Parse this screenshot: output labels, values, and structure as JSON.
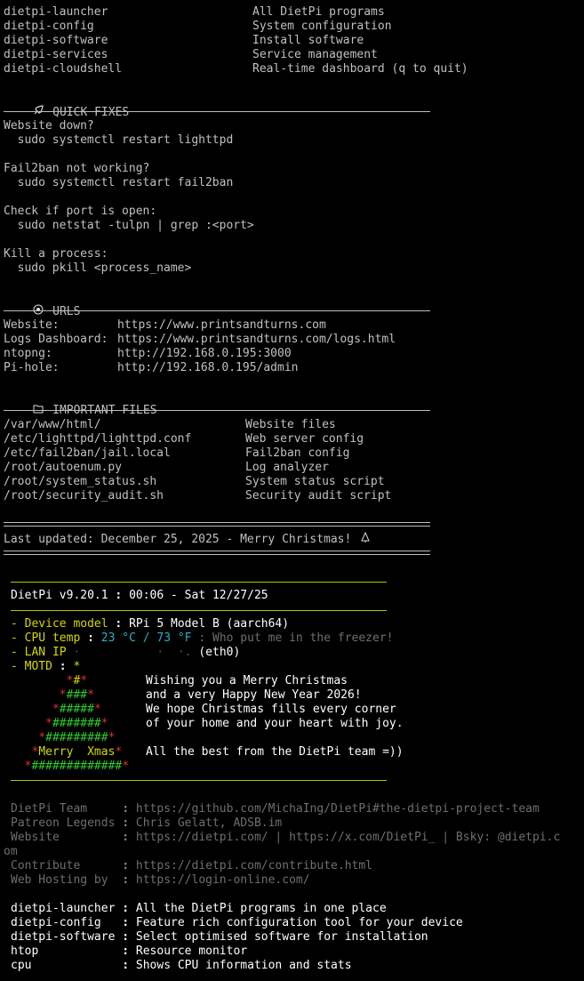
{
  "commands": [
    {
      "cmd": "dietpi-launcher",
      "desc": "All DietPi programs"
    },
    {
      "cmd": "dietpi-config",
      "desc": "System configuration"
    },
    {
      "cmd": "dietpi-software",
      "desc": "Install software"
    },
    {
      "cmd": "dietpi-services",
      "desc": "Service management"
    },
    {
      "cmd": "dietpi-cloudshell",
      "desc": "Real-time dashboard (q to quit)"
    }
  ],
  "quick_fixes": {
    "title": "QUICK FIXES",
    "icon": "rocket-icon",
    "items": [
      {
        "q": "Website down?",
        "a": "  sudo systemctl restart lighttpd"
      },
      {
        "q": "Fail2ban not working?",
        "a": "  sudo systemctl restart fail2ban"
      },
      {
        "q": "Check if port is open:",
        "a": "  sudo netstat -tulpn | grep :<port>"
      },
      {
        "q": "Kill a process:",
        "a": "  sudo pkill <process_name>"
      }
    ]
  },
  "urls": {
    "title": "URLS",
    "icon": "target-icon",
    "items": [
      {
        "label": "Website:",
        "value": "https://www.printsandturns.com"
      },
      {
        "label": "Logs Dashboard:",
        "value": "https://www.printsandturns.com/logs.html"
      },
      {
        "label": "ntopng:",
        "value": "http://192.168.0.195:3000"
      },
      {
        "label": "Pi-hole:",
        "value": "http://192.168.0.195/admin"
      }
    ]
  },
  "files": {
    "title": "IMPORTANT FILES",
    "icon": "folder-icon",
    "items": [
      {
        "path": "/var/www/html/",
        "desc": "Website files"
      },
      {
        "path": "/etc/lighttpd/lighttpd.conf",
        "desc": "Web server config"
      },
      {
        "path": "/etc/fail2ban/jail.local",
        "desc": "Fail2ban config"
      },
      {
        "path": "/root/autoenum.py",
        "desc": "Log analyzer"
      },
      {
        "path": "/root/system_status.sh",
        "desc": "System status script"
      },
      {
        "path": "/root/security_audit.sh",
        "desc": "Security audit script"
      }
    ]
  },
  "last_updated": "Last updated: December 25, 2025 - Merry Christmas! ",
  "banner": {
    "title_a": "DietPi v9.20.1",
    "sep": ":",
    "title_b": "00:06 - Sat 12/27/25",
    "device_label": "- Device model",
    "device_value": "RPi 5 Model B (aarch64)",
    "cpu_label": "- CPU temp",
    "cpu_value": "23 °C / 73 °F",
    "cpu_comment": "Who put me in the freezer!",
    "lan_label": "- LAN IP",
    "lan_value": "(eth0)",
    "motd_label": "- MOTD",
    "motd_star": "*",
    "tree": [
      {
        "pre": "        ",
        "s1": "*",
        "mid": "#",
        "s2": "*"
      },
      {
        "pre": "       ",
        "s1": "*",
        "mid": "###",
        "s2": "*"
      },
      {
        "pre": "      ",
        "s1": "*",
        "mid": "#####",
        "s2": "*"
      },
      {
        "pre": "     ",
        "s1": "*",
        "mid": "#######",
        "s2": "*"
      },
      {
        "pre": "    ",
        "s1": "*",
        "mid": "#########",
        "s2": "*"
      },
      {
        "pre": "   ",
        "s1": "*",
        "mid": "Merry  Xmas",
        "s2": "*"
      },
      {
        "pre": "  ",
        "s1": "*",
        "mid": "#############",
        "s2": "*"
      }
    ],
    "messages": [
      "Wishing you a Merry Christmas",
      "and a very Happy New Year 2026!",
      "We hope Christmas fills every corner",
      "of your home and your heart with joy.",
      "",
      "All the best from the DietPi team =))"
    ]
  },
  "credits": [
    {
      "label": "DietPi Team     ",
      "value": "https://github.com/MichaIng/DietPi#the-dietpi-project-team"
    },
    {
      "label": "Patreon Legends ",
      "value": "Chris Gelatt, ADSB.im"
    },
    {
      "label": "Website         ",
      "value": "https://dietpi.com/ | https://x.com/DietPi_ | Bsky: @dietpi.c"
    },
    {
      "label": "",
      "value": "om"
    },
    {
      "label": "Contribute      ",
      "value": "https://dietpi.com/contribute.html"
    },
    {
      "label": "Web Hosting by  ",
      "value": "https://login-online.com/"
    }
  ],
  "tools": [
    {
      "cmd": "dietpi-launcher ",
      "desc": "All the DietPi programs in one place"
    },
    {
      "cmd": "dietpi-config   ",
      "desc": "Feature rich configuration tool for your device"
    },
    {
      "cmd": "dietpi-software ",
      "desc": "Select optimised software for installation"
    },
    {
      "cmd": "htop            ",
      "desc": "Resource monitor"
    },
    {
      "cmd": "cpu             ",
      "desc": "Shows CPU information and stats"
    }
  ]
}
